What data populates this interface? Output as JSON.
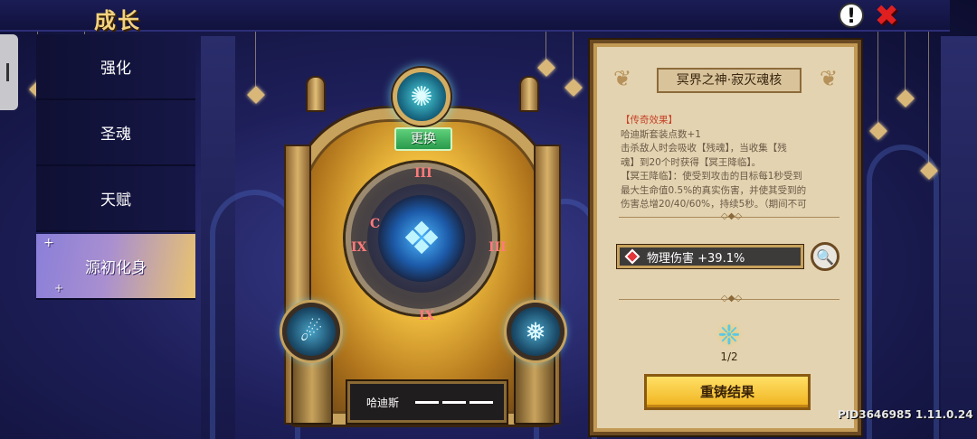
{
  "header": {
    "title": "成长",
    "help_glyph": "!",
    "close_glyph": "✖"
  },
  "tabs": [
    {
      "label": "强化",
      "active": false
    },
    {
      "label": "圣魂",
      "active": false
    },
    {
      "label": "天赋",
      "active": false
    },
    {
      "label": "源初化身",
      "active": true
    }
  ],
  "center": {
    "swap_label": "更换",
    "numerals": [
      "III",
      "C",
      "III",
      "IX",
      "IX"
    ],
    "name_plate": {
      "name": "哈迪斯"
    }
  },
  "panel": {
    "title": "冥界之神·寂灭魂核",
    "desc_lines": [
      "【传奇效果】",
      "哈迪斯套装点数+1",
      "击杀敌人时会吸收【残魂】，当收集【残",
      "魂】到20个时获得【冥王降临】。",
      "【冥王降临】：使受到攻击的目标每1秒受到",
      "最大生命值0.5%的真实伤害，并使其受到的",
      "伤害总增20/40/60%，持续5秒。（期间不可"
    ],
    "stat_label": "物理伤害 +39.1%",
    "material_count": "1/2",
    "reforge_label": "重铸结果"
  },
  "footer": {
    "pid": "PID3646985 1.11.0.24"
  },
  "colors": {
    "accent_gold": "#f3d27f",
    "active_tab": "#a98fd0",
    "reforge": "#f0b21e"
  }
}
